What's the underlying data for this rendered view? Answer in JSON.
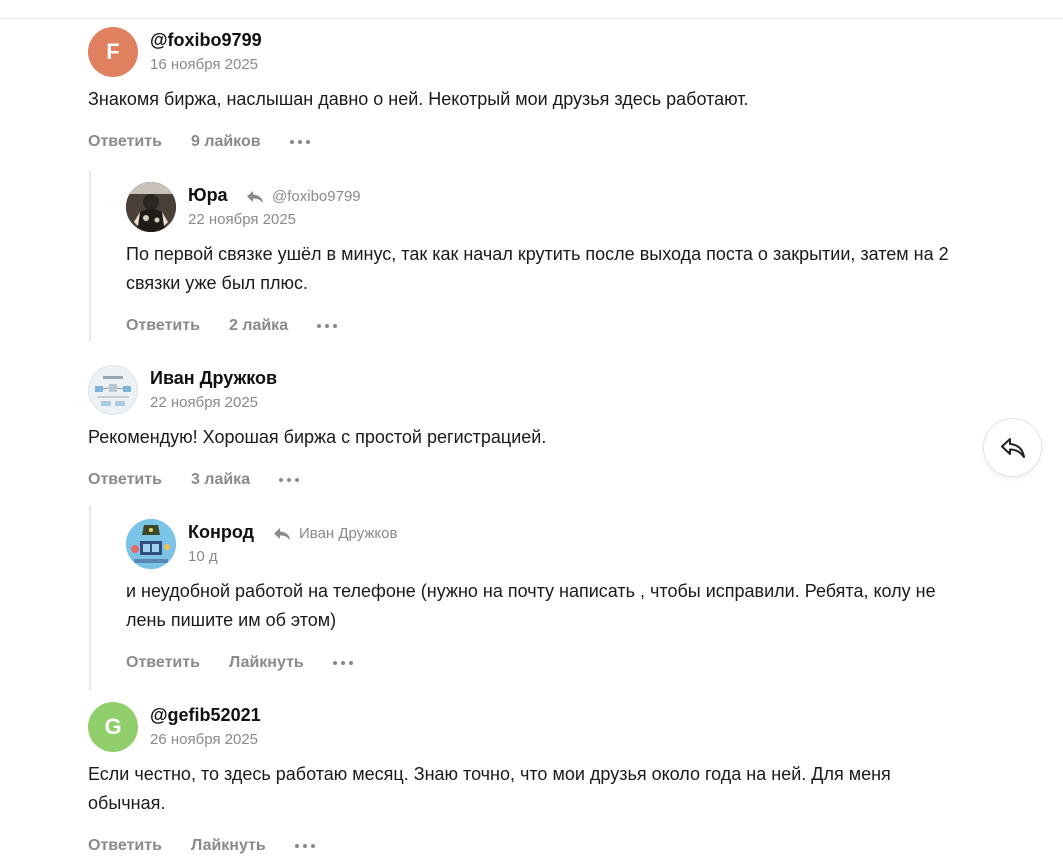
{
  "comments": [
    {
      "avatar_letter": "F",
      "avatar_color": "#e0805f",
      "author": "@foxibo9799",
      "date": "16 ноября 2025",
      "text": "Знакомя биржа, наслышан давно о ней. Некотрый мои друзья здесь работают.",
      "reply_label": "Ответить",
      "likes_label": "9 лайков"
    },
    {
      "avatar_icon": "user-photo-avatar",
      "author": "Юра",
      "reply_to": "@foxibo9799",
      "date": "22 ноября 2025",
      "text": "По первой связке ушёл в минус, так как начал крутить после выхода поста о закрытии, затем на 2 связки уже был плюс.",
      "reply_label": "Ответить",
      "likes_label": "2 лайка"
    },
    {
      "avatar_icon": "diagram-thumbnail-avatar",
      "author": "Иван Дружков",
      "date": "22 ноября 2025",
      "text": "Рекомендую! Хорошая биржа с простой регистрацией.",
      "reply_label": "Ответить",
      "likes_label": "3 лайка"
    },
    {
      "avatar_icon": "illustrated-avatar",
      "author": "Конрод",
      "reply_to": "Иван Дружков",
      "date": "10 д",
      "text": "и неудобной работой на телефоне (нужно на почту написать , чтобы исправили. Ребята, колу не лень пишите им об этом)",
      "reply_label": "Ответить",
      "likes_label": "Лайкнуть"
    },
    {
      "avatar_letter": "G",
      "avatar_color": "#8fce6a",
      "author": "@gefib52021",
      "date": "26 ноября 2025",
      "text": "Если честно, то здесь работаю месяц. Знаю точно, что мои друзья около года на ней. Для меня обычная.",
      "reply_label": "Ответить",
      "likes_label": "Лайкнуть"
    }
  ],
  "share_button_icon": "share-arrow-icon",
  "colors": {
    "muted": "#8a8a8a",
    "text": "#1a1a1a"
  }
}
